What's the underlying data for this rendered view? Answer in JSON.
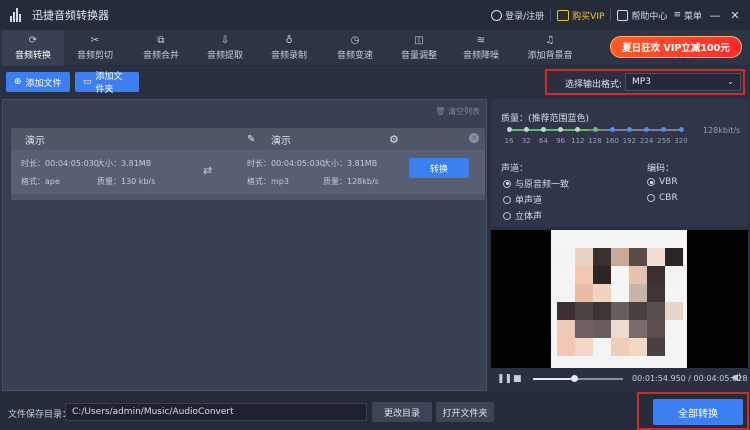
{
  "app": {
    "title": "迅捷音频转换器"
  },
  "titlebar": {
    "login": "登录/注册",
    "vip": "购买VIP",
    "help": "帮助中心",
    "menu": "菜单"
  },
  "nav": {
    "tabs": [
      {
        "label": "音频转换",
        "icon": "refresh-icon"
      },
      {
        "label": "音频剪切",
        "icon": "scissors-icon"
      },
      {
        "label": "音频合并",
        "icon": "merge-icon"
      },
      {
        "label": "音频提取",
        "icon": "extract-icon"
      },
      {
        "label": "音频录制",
        "icon": "mic-icon"
      },
      {
        "label": "音频变速",
        "icon": "speed-icon"
      },
      {
        "label": "音量调整",
        "icon": "volume-icon"
      },
      {
        "label": "音频降噪",
        "icon": "denoise-icon"
      },
      {
        "label": "添加背景音",
        "icon": "music-note-icon"
      }
    ],
    "active_index": 5,
    "promo": "夏日狂欢 VIP立减100元"
  },
  "toolbar": {
    "add_file": "添加文件",
    "add_folder": "添加文件夹",
    "format_label": "选择输出格式:",
    "format_value": "MP3"
  },
  "list": {
    "clear": "清空列表",
    "item": {
      "src_name": "演示",
      "dst_name": "演示",
      "src_duration": "时长：00:04:05:030",
      "src_size": "大小：3.81MB",
      "src_format": "格式：ape",
      "src_quality": "质量：130 kb/s",
      "dst_duration": "时长：00:04:05:030",
      "dst_size": "大小：3.81MB",
      "dst_format": "格式：mp3",
      "dst_quality": "质量：128kb/s",
      "convert": "转换"
    }
  },
  "settings": {
    "quality_label": "质量：(推荐范围蓝色)",
    "quality_ticks": [
      "16",
      "32",
      "64",
      "96",
      "112",
      "128",
      "160",
      "192",
      "224",
      "256",
      "320"
    ],
    "quality_value": "128kbit/s",
    "channel_label": "声道：",
    "channels": [
      "与原音频一致",
      "单声道",
      "立体声"
    ],
    "channel_selected": 0,
    "encoding_label": "编码：",
    "encodings": [
      "VBR",
      "CBR"
    ],
    "encoding_selected": 0
  },
  "player": {
    "time": "00:01:54.950 / 00:04:05:028",
    "progress": 0.47
  },
  "footer": {
    "path_label": "文件保存目录：",
    "path_value": "C:/Users/admin/Music/AudioConvert",
    "change_dir": "更改目录",
    "open_folder": "打开文件夹",
    "convert_all": "全部转换"
  },
  "colors": {
    "accent": "#3d7ff0",
    "highlight_box": "#d22a2a",
    "promo": "#ff3a2a",
    "vip": "#f0c040"
  }
}
